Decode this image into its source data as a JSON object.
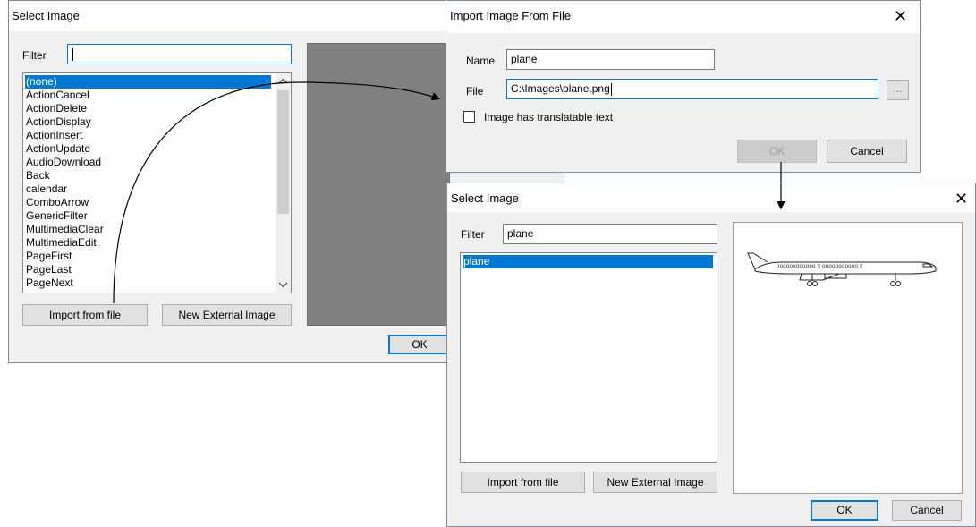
{
  "colors": {
    "accent": "#0078d7",
    "preview_gray": "#808080",
    "dialog_bg": "#f0f0f0"
  },
  "dialog1": {
    "title": "Select Image",
    "filter_label": "Filter",
    "filter_value": "",
    "items": [
      "(none)",
      "ActionCancel",
      "ActionDelete",
      "ActionDisplay",
      "ActionInsert",
      "ActionUpdate",
      "AudioDownload",
      "Back",
      "calendar",
      "ComboArrow",
      "GenericFilter",
      "MultimediaClear",
      "MultimediaEdit",
      "PageFirst",
      "PageLast",
      "PageNext"
    ],
    "import_button": "Import from file",
    "external_button": "New External Image",
    "ok_button": "OK"
  },
  "dialog2": {
    "title": "Import Image From File",
    "name_label": "Name",
    "name_value": "plane",
    "file_label": "File",
    "file_value": "C:\\Images\\plane.png",
    "browse_button": "...",
    "translatable_label": "Image has translatable text",
    "translatable_checked": false,
    "ok_button": "OK",
    "cancel_button": "Cancel"
  },
  "dialog3": {
    "title": "Select Image",
    "filter_label": "Filter",
    "filter_value": "plane",
    "items": [
      "plane"
    ],
    "import_button": "Import from file",
    "external_button": "New External Image",
    "ok_button": "OK",
    "cancel_button": "Cancel"
  },
  "icons": {
    "close": "close-icon",
    "scroll_up": "scroll-up-arrow-icon",
    "scroll_down": "scroll-down-arrow-icon",
    "preview": "airplane-icon"
  }
}
